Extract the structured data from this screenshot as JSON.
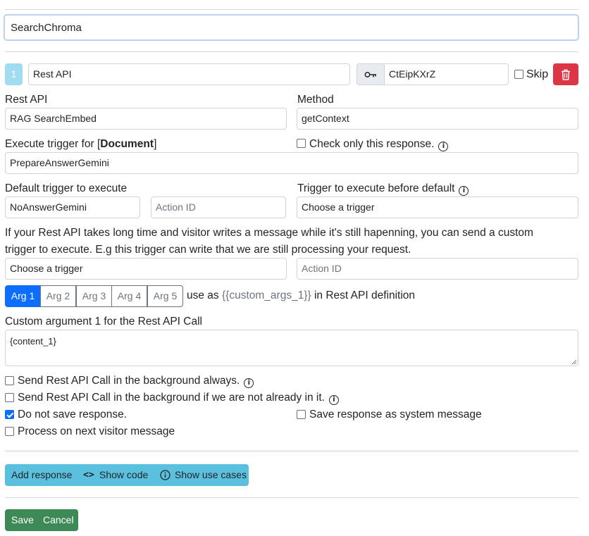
{
  "search_value": "SearchChroma",
  "response": {
    "index": "1",
    "name_value": "Rest API",
    "key_value": "CtEipKXrZ",
    "skip_label": "Skip"
  },
  "rest_api": {
    "label": "Rest API",
    "value": "RAG SearchEmbed",
    "method_label": "Method",
    "method_value": "getContext"
  },
  "execute_trigger": {
    "label_prefix": "Execute trigger for [",
    "label_bold": "Document",
    "label_suffix": "]",
    "value": "PrepareAnswerGemini",
    "check_only_label": "Check only this response."
  },
  "default_trigger": {
    "label": "Default trigger to execute",
    "value": "NoAnswerGemini",
    "action_id_placeholder": "Action ID",
    "before_label": "Trigger to execute before default",
    "before_value": "Choose a trigger"
  },
  "long_time": {
    "text_line1": "If your Rest API takes long time and visitor writes a message while it's still hapenning, you can send a custom",
    "text_line2": "trigger to execute. E.g this trigger can write that we are still processing your request.",
    "trigger_value": "Choose a trigger",
    "action_id_placeholder": "Action ID"
  },
  "args": {
    "tabs": [
      "Arg 1",
      "Arg 2",
      "Arg 3",
      "Arg 4",
      "Arg 5"
    ],
    "active_index": 0,
    "use_as_prefix": "use as",
    "use_as_token": "{{custom_args_1}}",
    "use_as_suffix": "in Rest API definition",
    "custom_label": "Custom argument 1 for the Rest API Call",
    "custom_value": "{content_1}"
  },
  "options": {
    "bg_always": {
      "label": "Send Rest API Call in the background always.",
      "checked": false
    },
    "bg_if_not": {
      "label": "Send Rest API Call in the background if we are not already in it.",
      "checked": false
    },
    "no_save": {
      "label": "Do not save response.",
      "checked": true
    },
    "save_system": {
      "label": "Save response as system message",
      "checked": false
    },
    "process_next": {
      "label": "Process on next visitor message",
      "checked": false
    }
  },
  "actions": {
    "add_response": "Add response",
    "show_code": "Show code",
    "show_use_cases": "Show use cases",
    "save": "Save",
    "cancel": "Cancel"
  },
  "colors": {
    "primary": "#0d6efd",
    "danger": "#dc3545",
    "info": "#5bc0de",
    "success": "#3d8a57",
    "badge": "#9fdcf0"
  }
}
